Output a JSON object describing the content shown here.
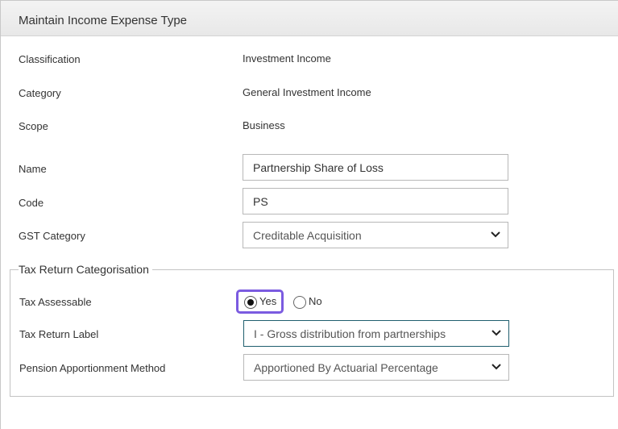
{
  "header": {
    "title": "Maintain Income Expense Type"
  },
  "info": {
    "classification_label": "Classification",
    "classification_value": "Investment Income",
    "category_label": "Category",
    "category_value": "General Investment Income",
    "scope_label": "Scope",
    "scope_value": "Business"
  },
  "form": {
    "name_label": "Name",
    "name_value": "Partnership Share of Loss",
    "code_label": "Code",
    "code_value": "PS",
    "gst_label": "GST Category",
    "gst_value": "Creditable Acquisition"
  },
  "tax": {
    "legend": "Tax Return Categorisation",
    "assessable_label": "Tax Assessable",
    "yes_label": "Yes",
    "no_label": "No",
    "assessable_selected": "Yes",
    "return_label_label": "Tax Return Label",
    "return_label_value": "I - Gross distribution from partnerships",
    "pension_label": "Pension Apportionment Method",
    "pension_value": "Apportioned By Actuarial Percentage"
  },
  "icons": {
    "dropdown": "chevron-down-icon"
  },
  "colors": {
    "focus": "#7b5be0",
    "header_bg": "#ececec",
    "active_border": "#1f5e6e"
  }
}
